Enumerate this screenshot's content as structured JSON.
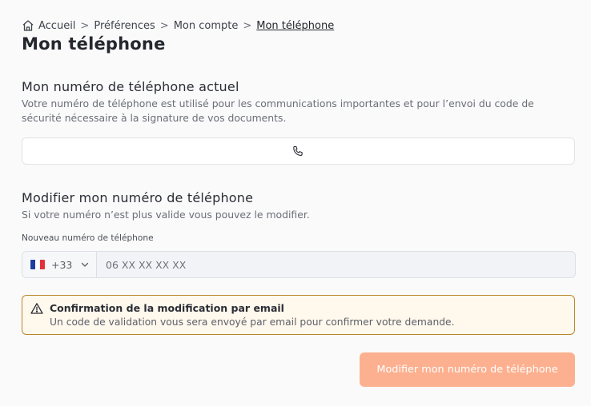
{
  "breadcrumb": {
    "items": [
      "Accueil",
      "Préférences",
      "Mon compte"
    ],
    "current": "Mon téléphone",
    "separator": ">"
  },
  "page": {
    "title": "Mon téléphone"
  },
  "current_phone": {
    "title": "Mon numéro de téléphone actuel",
    "description": "Votre numéro de téléphone est utilisé pour les communications importantes et pour l’envoi du code de sécurité nécessaire à la signature de vos documents.",
    "value": "",
    "icon": "phone-icon"
  },
  "modify_phone": {
    "title": "Modifier mon numéro de téléphone",
    "description": "Si votre numéro n’est plus valide vous pouvez le modifier.",
    "field_label": "Nouveau numéro de téléphone",
    "country_code": "+33",
    "country_flag": "france-flag-icon",
    "placeholder": "06 XX XX XX XX",
    "value": ""
  },
  "alert": {
    "title": "Confirmation de la modification par email",
    "text": "Un code de validation vous sera envoyé par email pour confirmer votre demande.",
    "icon": "warning-icon",
    "border_color": "#b8872c",
    "background": "#fff8ed"
  },
  "submit": {
    "label": "Modifier mon numéro de téléphone",
    "color": "#fcb08f",
    "state": "disabled"
  }
}
